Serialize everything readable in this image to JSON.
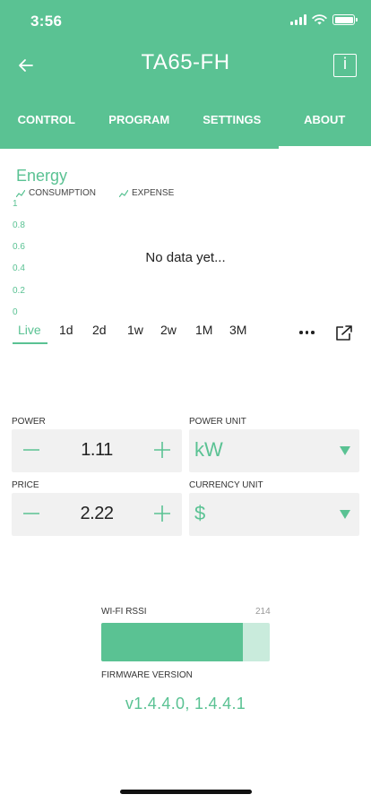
{
  "status_bar": {
    "time": "3:56"
  },
  "header": {
    "title": "TA65-FH",
    "info_label": "i"
  },
  "tabs": [
    {
      "label": "CONTROL",
      "active": false
    },
    {
      "label": "PROGRAM",
      "active": false
    },
    {
      "label": "SETTINGS",
      "active": false
    },
    {
      "label": "ABOUT",
      "active": true
    }
  ],
  "chart_data": {
    "type": "line",
    "title": "Energy",
    "series": [
      {
        "name": "CONSUMPTION",
        "values": []
      },
      {
        "name": "EXPENSE",
        "values": []
      }
    ],
    "y_ticks": [
      "1",
      "0.8",
      "0.6",
      "0.4",
      "0.2",
      "0"
    ],
    "ylim": [
      0,
      1
    ],
    "empty_message": "No data yet..."
  },
  "ranges": [
    {
      "label": "Live",
      "active": true
    },
    {
      "label": "1d",
      "active": false
    },
    {
      "label": "2d",
      "active": false
    },
    {
      "label": "1w",
      "active": false
    },
    {
      "label": "2w",
      "active": false
    },
    {
      "label": "1M",
      "active": false
    },
    {
      "label": "3M",
      "active": false
    }
  ],
  "power": {
    "label": "POWER",
    "value": "1.11"
  },
  "power_unit": {
    "label": "POWER UNIT",
    "value": "kW"
  },
  "price": {
    "label": "PRICE",
    "value": "2.22"
  },
  "currency_unit": {
    "label": "CURRENCY UNIT",
    "value": "$"
  },
  "wifi": {
    "label": "WI-FI RSSI",
    "value": "214",
    "fill_fraction": 0.84
  },
  "firmware": {
    "label": "FIRMWARE VERSION",
    "value": "v1.4.4.0, 1.4.4.1"
  },
  "colors": {
    "accent": "#5ac293",
    "accent_light": "#c9ebdc",
    "field_bg": "#f1f1f1"
  }
}
